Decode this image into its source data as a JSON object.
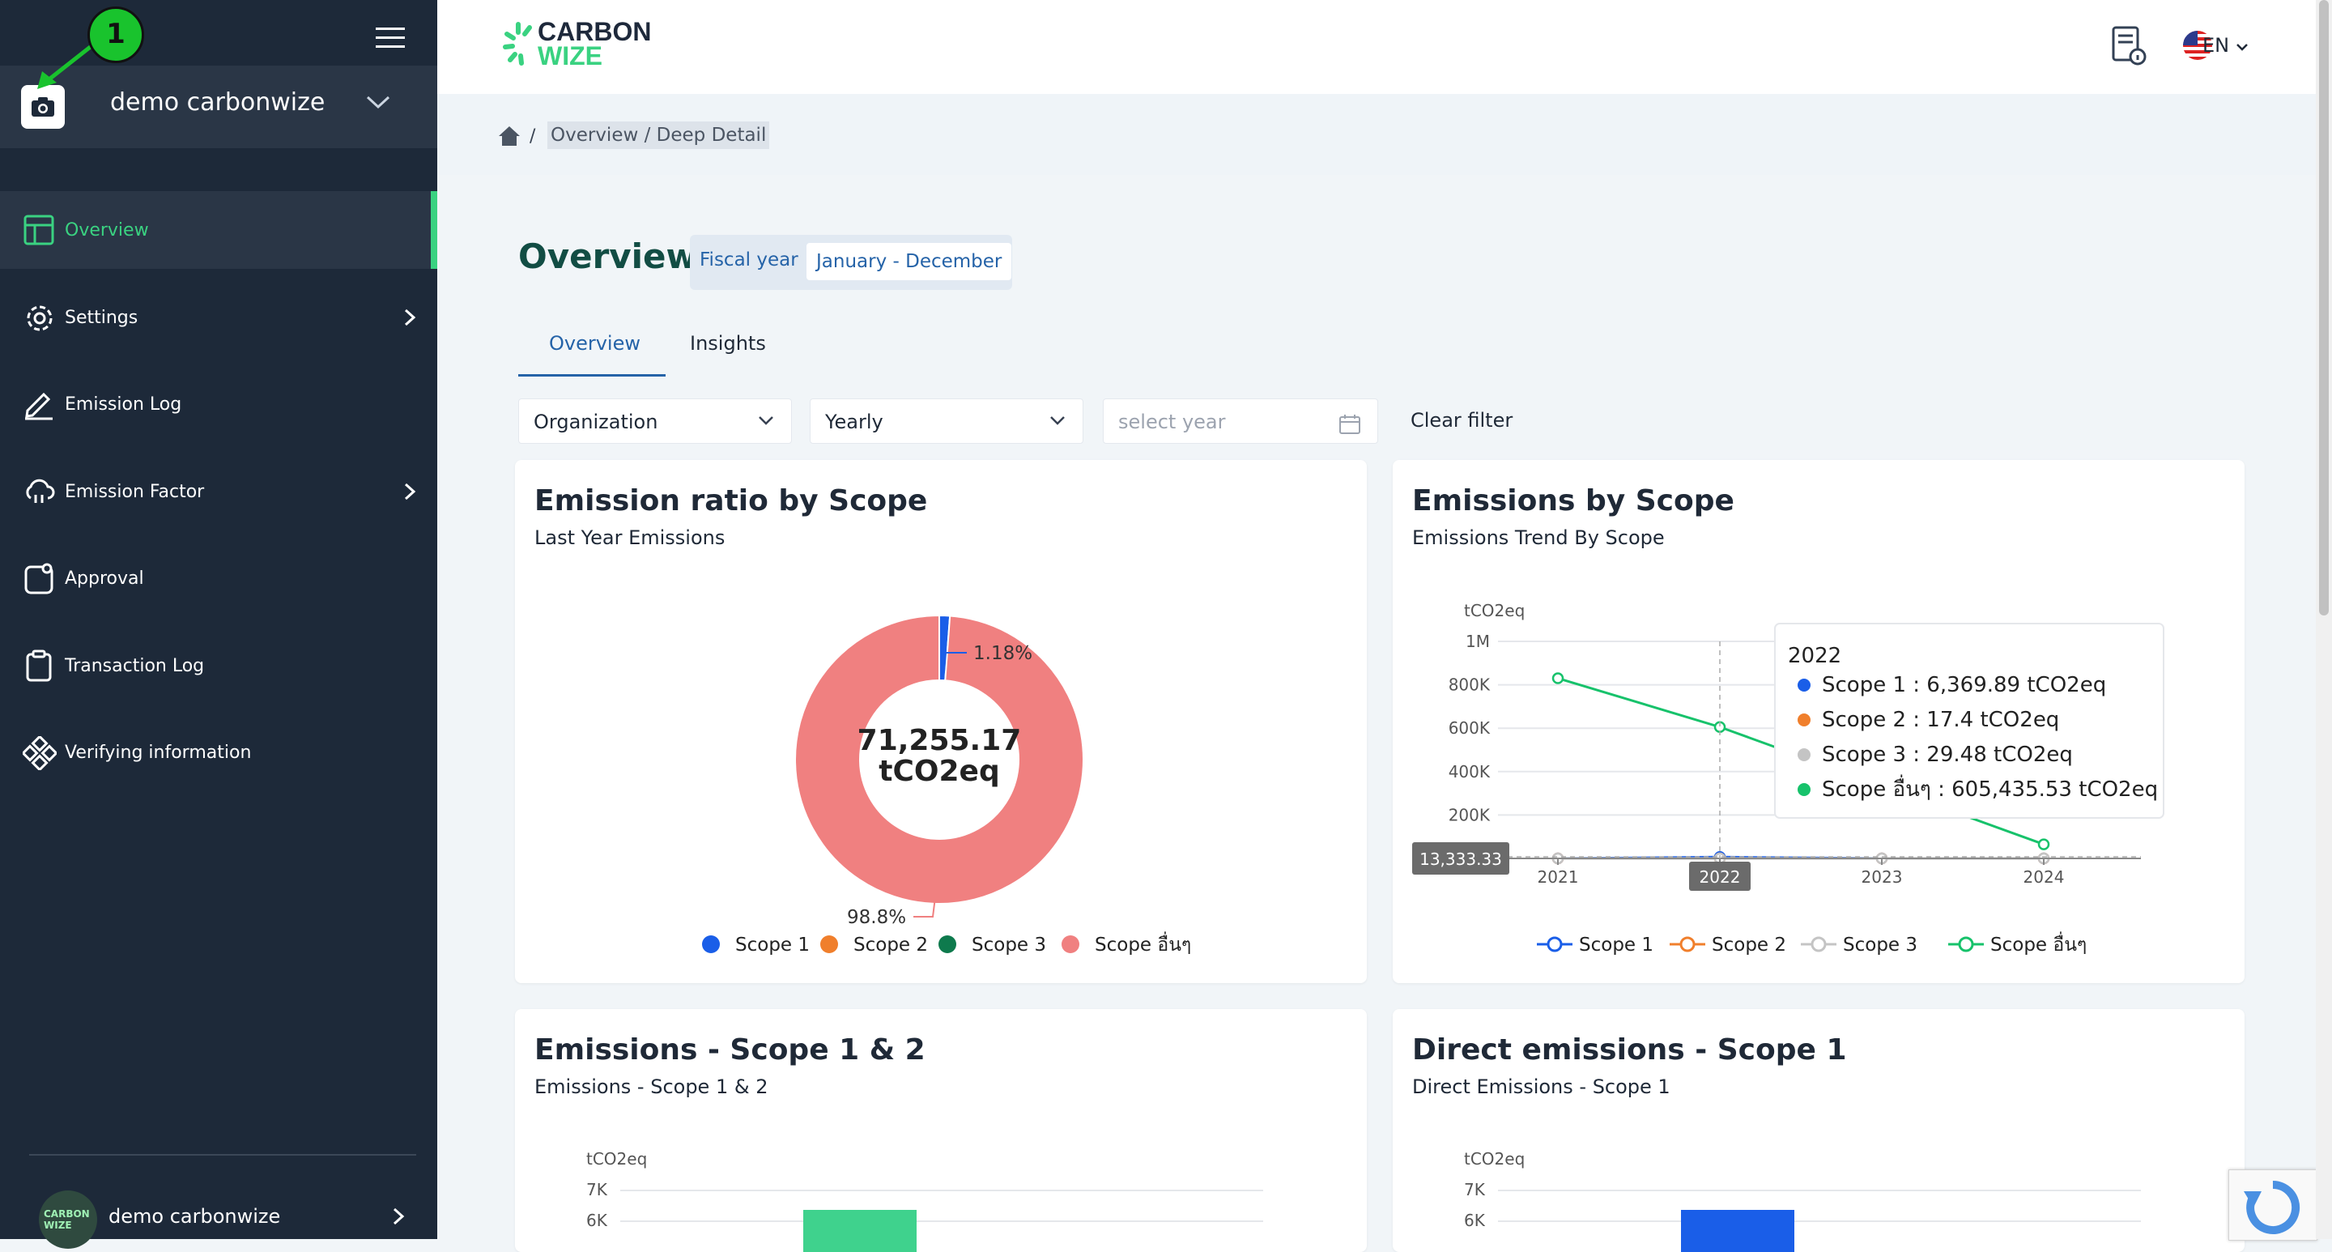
{
  "sidebar": {
    "org_name": "demo carbonwize",
    "step_badge": "1",
    "items": [
      {
        "label": "Overview",
        "icon": "layout-icon",
        "active": true
      },
      {
        "label": "Settings",
        "icon": "gear-icon",
        "has_children": true
      },
      {
        "label": "Emission Log",
        "icon": "pencil-icon"
      },
      {
        "label": "Emission Factor",
        "icon": "cloud-icon",
        "has_children": true
      },
      {
        "label": "Approval",
        "icon": "approval-icon"
      },
      {
        "label": "Transaction Log",
        "icon": "clipboard-icon"
      },
      {
        "label": "Verifying information",
        "icon": "nodes-icon"
      }
    ],
    "user": {
      "name": "demo carbonwize",
      "avatar_text": "CARBON WIZE"
    }
  },
  "header": {
    "logo_line1": "CARBON",
    "logo_line2": "WIZE",
    "language": "EN"
  },
  "breadcrumb": {
    "separator": "/",
    "current": "Overview / Deep Detail"
  },
  "page": {
    "title": "Overview",
    "fiscal_label": "Fiscal year",
    "fiscal_value": "January - December"
  },
  "tabs": [
    "Overview",
    "Insights"
  ],
  "filters": {
    "organization": "Organization",
    "period": "Yearly",
    "year_placeholder": "select year",
    "clear": "Clear filter"
  },
  "cards": {
    "ratio": {
      "title": "Emission ratio by Scope",
      "subtitle": "Last Year Emissions"
    },
    "by_scope": {
      "title": "Emissions by Scope",
      "subtitle": "Emissions Trend By Scope"
    },
    "scope12": {
      "title": "Emissions - Scope 1 & 2",
      "subtitle": "Emissions - Scope 1 & 2"
    },
    "direct": {
      "title": "Direct emissions - Scope 1",
      "subtitle": "Direct Emissions - Scope 1"
    }
  },
  "colors": {
    "scope1": "#1a5ee8",
    "scope2": "#f07f2c",
    "scope3": "#0e7a4d",
    "scope_other": "#f08080",
    "trend_scope1": "#1a5ee8",
    "trend_scope2": "#f07f2c",
    "trend_scope3": "#c4c4c4",
    "trend_other": "#17c26b",
    "bar_scope12": "#3fd28d",
    "bar_scope1": "#1a5ee8"
  },
  "chart_data": [
    {
      "type": "pie",
      "title": "Emission ratio by Scope",
      "subtitle": "Last Year Emissions",
      "center_value": "71,255.17",
      "center_unit": "tCO2eq",
      "labels": [
        "Scope 1",
        "Scope 2",
        "Scope 3",
        "Scope อื่นๆ"
      ],
      "values": [
        1.18,
        0,
        0,
        98.8
      ],
      "data_labels": [
        "1.18%",
        "",
        "",
        "98.8%"
      ],
      "legend": "bottom"
    },
    {
      "type": "line",
      "title": "Emissions by Scope",
      "subtitle": "Emissions Trend By Scope",
      "ylabel": "tCO2eq",
      "x": [
        "2021",
        "2022",
        "2023",
        "2024"
      ],
      "yticks": [
        "1M",
        "800K",
        "600K",
        "400K",
        "200K"
      ],
      "ylim": [
        0,
        1000000
      ],
      "series": [
        {
          "name": "Scope 1",
          "values": [
            0,
            6369.89,
            0,
            0
          ]
        },
        {
          "name": "Scope 2",
          "values": [
            0,
            17.4,
            0,
            0
          ]
        },
        {
          "name": "Scope 3",
          "values": [
            0,
            29.48,
            0,
            0
          ]
        },
        {
          "name": "Scope อื่นๆ",
          "values": [
            830000,
            605435.53,
            null,
            65000
          ]
        }
      ],
      "tooltip": {
        "title": "2022",
        "rows": [
          {
            "label": "Scope 1 : 6,369.89 tCO2eq"
          },
          {
            "label": "Scope 2 : 17.4 tCO2eq"
          },
          {
            "label": "Scope 3 : 29.48 tCO2eq"
          },
          {
            "label": "Scope อื่นๆ : 605,435.53 tCO2eq"
          }
        ]
      },
      "crosshair_value": "13,333.33",
      "crosshair_x": "2022",
      "legend": "bottom"
    },
    {
      "type": "bar",
      "title": "Emissions - Scope 1 & 2",
      "ylabel": "tCO2eq",
      "yticks": [
        "7K",
        "6K"
      ]
    },
    {
      "type": "bar",
      "title": "Direct emissions - Scope 1",
      "ylabel": "tCO2eq",
      "yticks": [
        "7K",
        "6K"
      ]
    }
  ]
}
